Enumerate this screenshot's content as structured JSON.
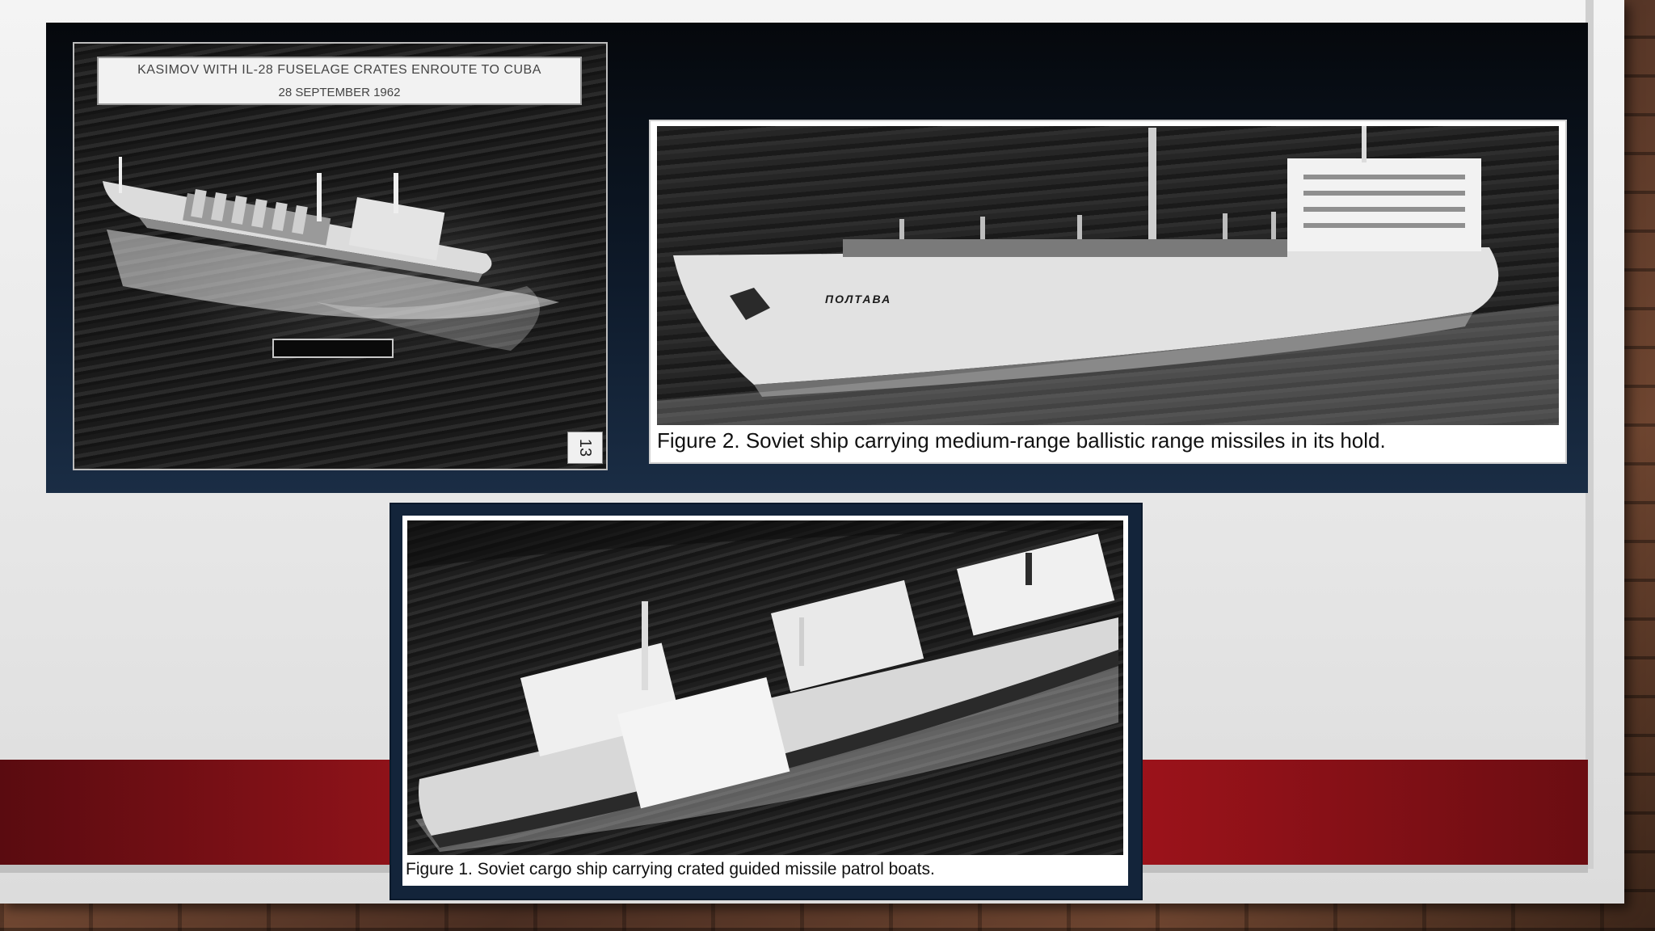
{
  "slide": {
    "photo_kasimov": {
      "caption_line1": "KASIMOV  WITH IL-28 FUSELAGE CRATES ENROUTE TO CUBA",
      "caption_line2": "28 SEPTEMBER 1962",
      "frame_number": "13"
    },
    "photo_poltava": {
      "hull_name": "ПОЛТАВА",
      "caption": "Figure 2. Soviet ship carrying medium-range ballistic range missiles in its hold."
    },
    "photo_cargo": {
      "caption": "Figure 1. Soviet cargo ship carrying crated guided missile patrol boats."
    }
  },
  "colors": {
    "red_band": "#b8161e",
    "panel_dark": "#0e1a2a",
    "frame_navy": "#13243a"
  }
}
